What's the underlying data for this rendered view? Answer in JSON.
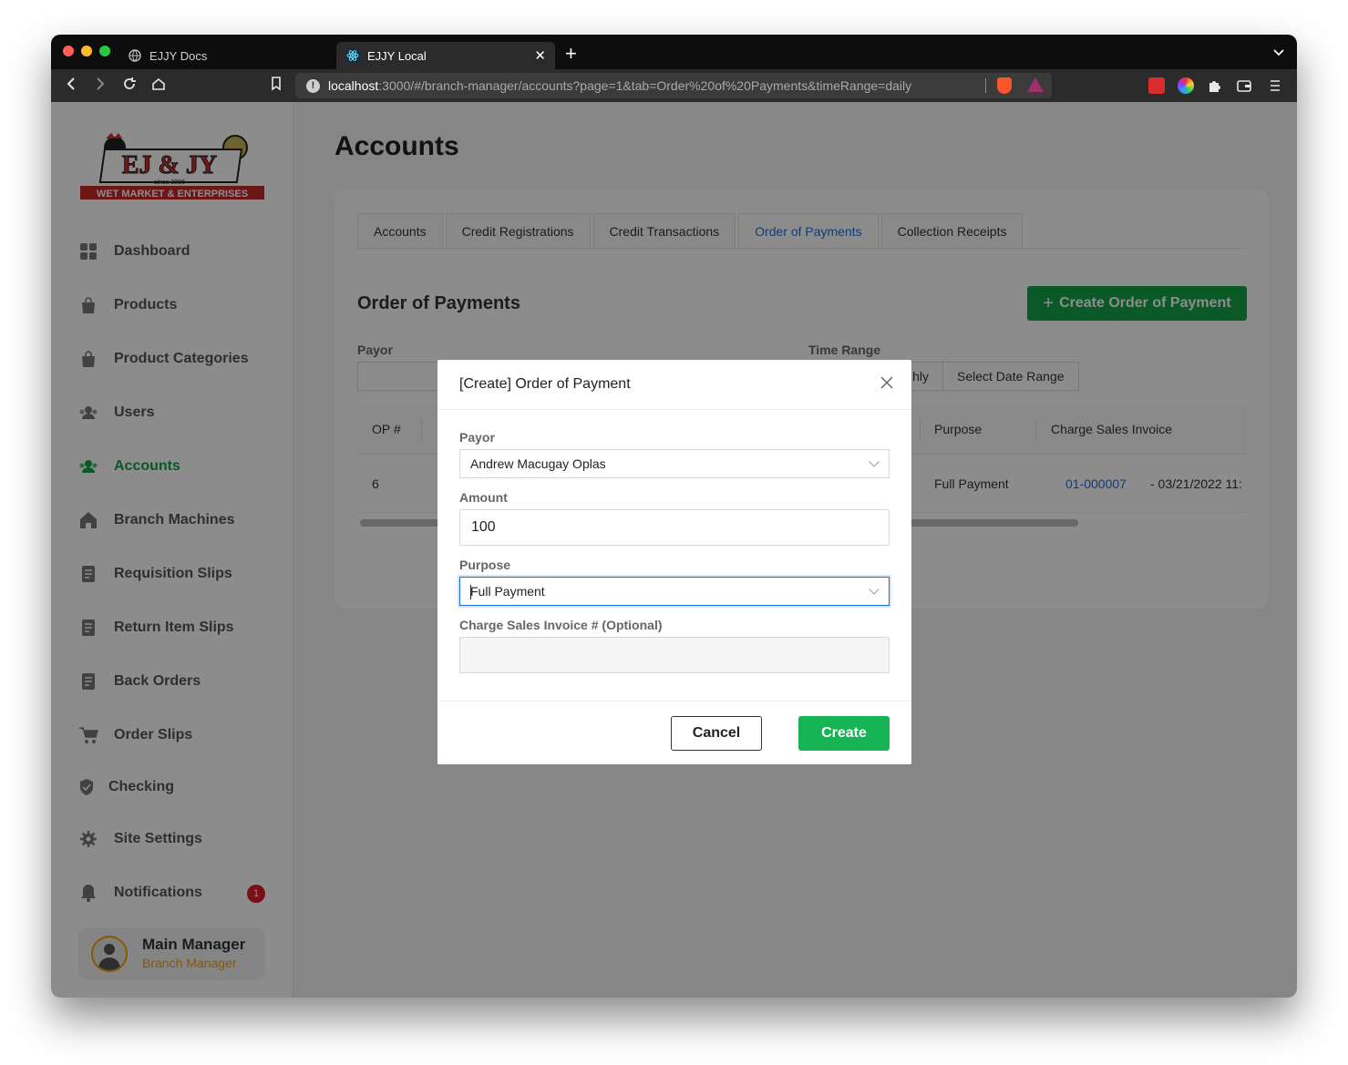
{
  "browser": {
    "tabs": [
      {
        "title": "EJJY Docs"
      },
      {
        "title": "EJJY Local"
      }
    ],
    "url_host": "localhost",
    "url_rest": ":3000/#/branch-manager/accounts?page=1&tab=Order%20of%20Payments&timeRange=daily"
  },
  "sidebar": {
    "items": [
      {
        "label": "Dashboard",
        "icon": "dashboard-icon"
      },
      {
        "label": "Products",
        "icon": "bag-icon"
      },
      {
        "label": "Product Categories",
        "icon": "bag-icon"
      },
      {
        "label": "Users",
        "icon": "users-icon"
      },
      {
        "label": "Accounts",
        "icon": "users-icon",
        "active": true
      },
      {
        "label": "Branch Machines",
        "icon": "home-icon"
      },
      {
        "label": "Requisition Slips",
        "icon": "document-icon"
      },
      {
        "label": "Return Item Slips",
        "icon": "document-icon"
      },
      {
        "label": "Back Orders",
        "icon": "document-icon"
      },
      {
        "label": "Order Slips",
        "icon": "cart-icon"
      },
      {
        "label": "Checking",
        "icon": "shield-icon"
      },
      {
        "label": "Site Settings",
        "icon": "gear-icon"
      },
      {
        "label": "Notifications",
        "icon": "bell-icon",
        "badge": "1"
      }
    ],
    "user": {
      "name": "Main Manager",
      "role": "Branch Manager"
    }
  },
  "page": {
    "title": "Accounts",
    "tabs": [
      "Accounts",
      "Credit Registrations",
      "Credit Transactions",
      "Order of Payments",
      "Collection Receipts"
    ],
    "active_tab": "Order of Payments",
    "section_title": "Order of Payments",
    "create_button": "Create Order of Payment",
    "filters": {
      "payor_label": "Payor",
      "time_range_label": "Time Range",
      "time_range_partial": "hly",
      "select_date_range": "Select Date Range"
    },
    "table": {
      "headers": [
        "OP #",
        "Purpose",
        "Charge Sales Invoice"
      ],
      "row": {
        "op": "6",
        "purpose": "Full Payment",
        "invoice": "01-000007",
        "invoice_date": "- 03/21/2022 11:"
      }
    }
  },
  "modal": {
    "title": "[Create] Order of Payment",
    "close_glyph": "X",
    "payor_label": "Payor",
    "payor_value": "Andrew Macugay Oplas",
    "amount_label": "Amount",
    "amount_value": "100",
    "purpose_label": "Purpose",
    "purpose_value": "Full Payment",
    "invoice_label": "Charge Sales Invoice # (Optional)",
    "invoice_value": "",
    "cancel": "Cancel",
    "submit": "Create"
  },
  "colors": {
    "accent": "#1e6fd9",
    "success": "#16a34a",
    "warning": "#f59e0b"
  }
}
